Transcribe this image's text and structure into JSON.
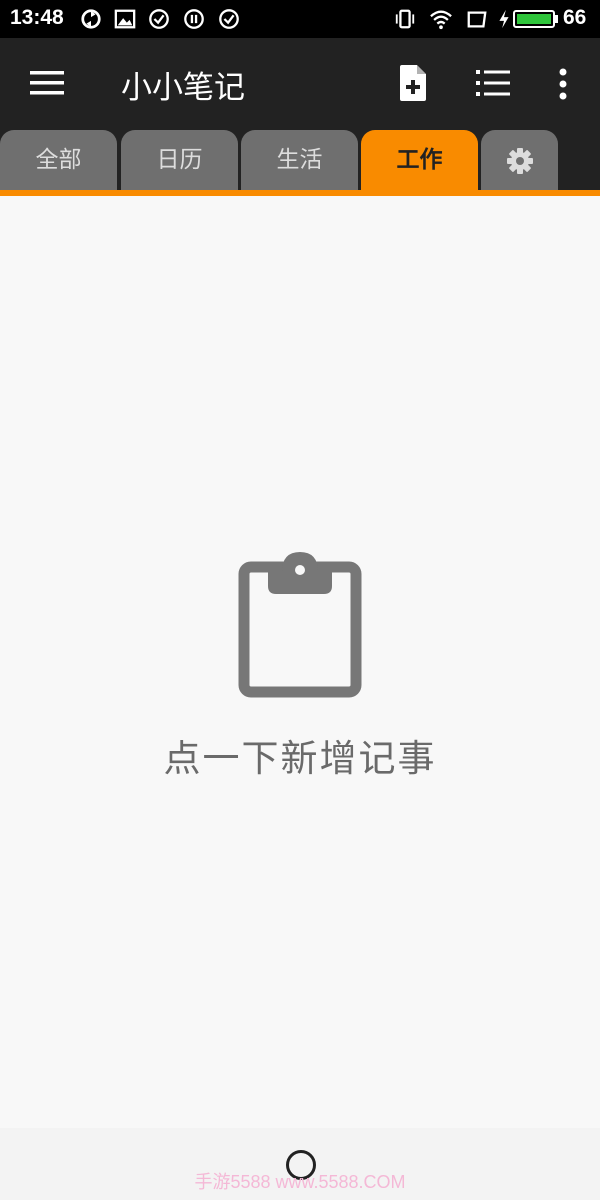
{
  "status_bar": {
    "time": "13:48",
    "battery_percent": "66",
    "icons": [
      "sync-icon",
      "image-icon",
      "check-circle-icon",
      "pause-circle-icon",
      "check-circle-icon",
      "vibrate-icon",
      "wifi-icon",
      "screen-icon",
      "charging-icon",
      "battery-icon"
    ]
  },
  "app_bar": {
    "title": "小小笔记",
    "icons": [
      "menu-icon",
      "add-note-icon",
      "list-icon",
      "more-vert-icon"
    ]
  },
  "tabs": [
    {
      "label": "全部",
      "active": false
    },
    {
      "label": "日历",
      "active": false
    },
    {
      "label": "生活",
      "active": false
    },
    {
      "label": "工作",
      "active": true
    },
    {
      "label": "",
      "icon": "gear-icon",
      "active": false
    }
  ],
  "empty_state": {
    "icon": "clipboard-icon",
    "text": "点一下新增记事"
  },
  "nav_bar": {
    "watermark": "手游5588 www.5588.COM"
  },
  "colors": {
    "accent": "#f98b00",
    "app_bar": "#222222",
    "tab_inactive": "#6f6f6f",
    "background": "#f8f8f8"
  }
}
